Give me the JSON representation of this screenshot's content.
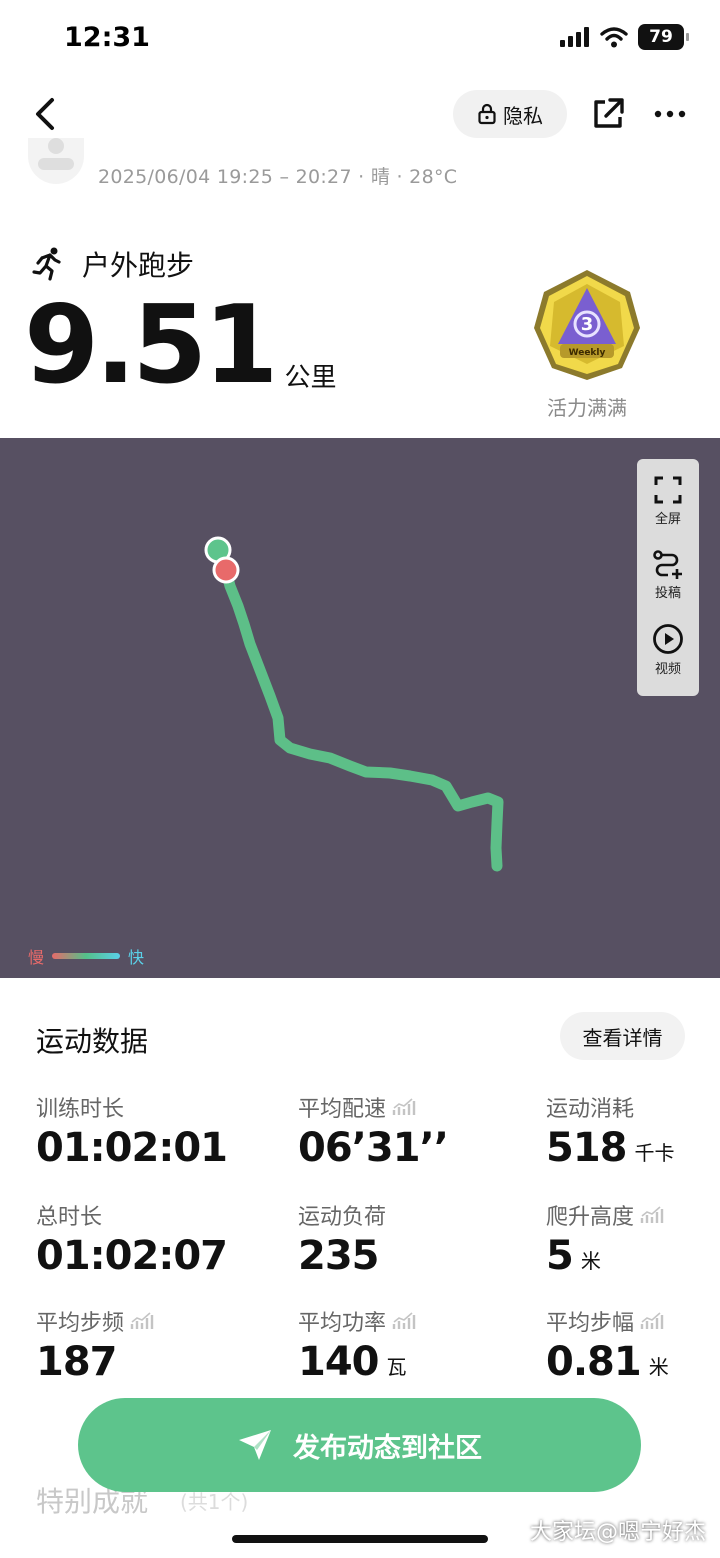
{
  "status_bar": {
    "time": "12:31",
    "battery": "79"
  },
  "nav": {
    "privacy_label": "隐私"
  },
  "record": {
    "meta": "2025/06/04 19:25 – 20:27 · 晴 · 28°C"
  },
  "sport": {
    "type": "户外跑步",
    "distance": "9.51",
    "distance_unit": "公里"
  },
  "badge": {
    "label": "活力满满",
    "text": "Weekly",
    "number": "3"
  },
  "map": {
    "controls": [
      {
        "label": "全屏",
        "icon": "fullscreen-icon"
      },
      {
        "label": "投稿",
        "icon": "route-submit-icon"
      },
      {
        "label": "视频",
        "icon": "play-video-icon"
      }
    ],
    "legend": {
      "slow": "慢",
      "fast": "快"
    },
    "colors": {
      "background": "#575062",
      "route": "#5dbf88",
      "start": "#5dc48c",
      "end": "#e86a6a"
    }
  },
  "stats": {
    "title": "运动数据",
    "details_label": "查看详情",
    "items": [
      {
        "label": "训练时长",
        "value": "01:02:01",
        "unit": ""
      },
      {
        "label": "平均配速",
        "value": "06’31’’",
        "unit": ""
      },
      {
        "label": "运动消耗",
        "value": "518",
        "unit": "千卡"
      },
      {
        "label": "总时长",
        "value": "01:02:07",
        "unit": ""
      },
      {
        "label": "运动负荷",
        "value": "235",
        "unit": ""
      },
      {
        "label": "爬升高度",
        "value": "5",
        "unit": "米"
      },
      {
        "label": "平均步频",
        "value": "187",
        "unit": ""
      },
      {
        "label": "平均功率",
        "value": "140",
        "unit": "瓦"
      },
      {
        "label": "平均步幅",
        "value": "0.81",
        "unit": "米"
      }
    ]
  },
  "special": {
    "title": "特别成就",
    "count": "(共1个)"
  },
  "publish": {
    "label": "发布动态到社区"
  },
  "watermark": "大家坛@嗯宁好杰"
}
